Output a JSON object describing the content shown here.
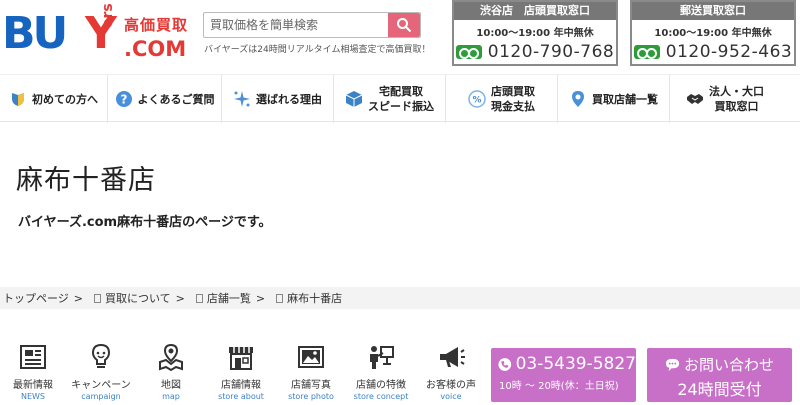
{
  "brand": {
    "logo_buy": "BU",
    "logo_y": "Y",
    "logo_ers": "ers",
    "logo_kouka": "高価買取",
    "logo_com": ".COM",
    "accent_color": "#e53935",
    "brand_color": "#1565c0"
  },
  "search": {
    "placeholder": "買取価格を簡単検索",
    "tagline": "バイヤーズは24時間リアルタイム相場査定で高価買取！",
    "button_icon": "search-icon"
  },
  "stores": [
    {
      "title": "渋谷店　店頭買取窓口",
      "hours": "10:00～19:00  年中無休",
      "tel": "0120-790-768"
    },
    {
      "title": "郵送買取窓口",
      "hours": "10:00～19:00  年中無休",
      "tel": "0120-952-463"
    }
  ],
  "nav": [
    {
      "label": "初めての方へ",
      "icon": "shield-icon"
    },
    {
      "label": "よくあるご質問",
      "icon": "question-icon"
    },
    {
      "label": "選ばれる理由",
      "icon": "sparkle-icon"
    },
    {
      "label": "宅配買取\nスピード振込",
      "icon": "box-icon"
    },
    {
      "label": "店頭買取\n現金支払",
      "icon": "cash-icon"
    },
    {
      "label": "買取店舗一覧",
      "icon": "map-pin-icon"
    },
    {
      "label": "法人・大口\n買取窓口",
      "icon": "handshake-icon"
    }
  ],
  "page": {
    "title": "麻布十番店",
    "description": "バイヤーズ.com麻布十番店のページです。"
  },
  "breadcrumb": [
    "トップページ",
    "買取について",
    "店舗一覧",
    "麻布十番店"
  ],
  "bottom_menu": [
    {
      "jp": "最新情報",
      "en": "NEWS",
      "icon": "news-icon"
    },
    {
      "jp": "キャンペーン",
      "en": "campaign",
      "icon": "lightbulb-icon"
    },
    {
      "jp": "地図",
      "en": "map",
      "icon": "map-icon"
    },
    {
      "jp": "店舗情報",
      "en": "store about",
      "icon": "storefront-icon"
    },
    {
      "jp": "店舗写真",
      "en": "store photo",
      "icon": "photo-icon"
    },
    {
      "jp": "店舗の特徴",
      "en": "store concept",
      "icon": "presenter-icon"
    },
    {
      "jp": "お客様の声",
      "en": "voice",
      "icon": "megaphone-icon"
    }
  ],
  "cta": {
    "tel": "03-5439-5827",
    "tel_hours": "10時 ～ 20時(休：土日祝)",
    "contact": "お問い合わせ",
    "contact_sub": "24時間受付",
    "color": "#c86fc8"
  }
}
